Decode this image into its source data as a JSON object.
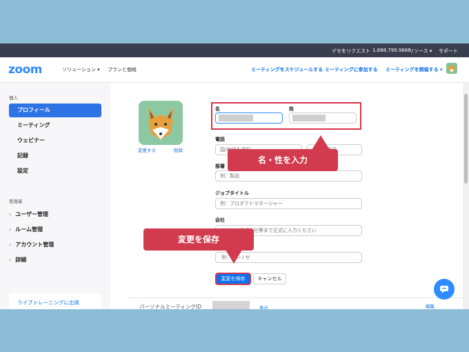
{
  "topbar": {
    "request_demo": "デモをリクエスト",
    "phone": "1.888.799.9666",
    "resources": "リソース ▾",
    "support": "サポート"
  },
  "nav": {
    "logo": "zoom",
    "solutions": "ソリューション ▾",
    "plans": "プランと価格",
    "schedule": "ミーティングをスケジュールする",
    "join": "ミーティングに参加する",
    "host": "ミーティングを開催する ▾"
  },
  "sidebar": {
    "personal_header": "個人",
    "items": [
      "プロフィール",
      "ミーティング",
      "ウェビナー",
      "記録",
      "設定"
    ],
    "admin_header": "管理者",
    "groups": [
      "ユーザー管理",
      "ルーム管理",
      "アカウント管理",
      "詳細"
    ],
    "card": "ライブトレーニングに出席"
  },
  "profile": {
    "change_link": "変更する",
    "delete_link": "削除",
    "first_name_label": "名",
    "last_name_label": "姓",
    "phone_label": "電話",
    "country_placeholder": "国/地域を選択",
    "phone_number_placeholder": "番号",
    "department_label": "部署",
    "department_placeholder": "例：製品",
    "job_title_label": "ジョブタイトル",
    "job_title_placeholder": "例：プロダクトマネージャー",
    "company_label": "会社",
    "company_placeholder": "会社名を株式会社等まで正式に入力ください",
    "location_placeholder": "例：サンノゼ",
    "save_button": "変更を保存",
    "cancel_button": "キャンセル",
    "pmi_label": "パーソナルミーティングID",
    "show_link": "表示",
    "edit_link": "編集"
  },
  "callouts": {
    "name": "名・性を入力",
    "save": "変更を保存"
  },
  "colors": {
    "accent": "#0e72ed",
    "callout": "#d23b4d",
    "background": "#8dbcd6"
  }
}
